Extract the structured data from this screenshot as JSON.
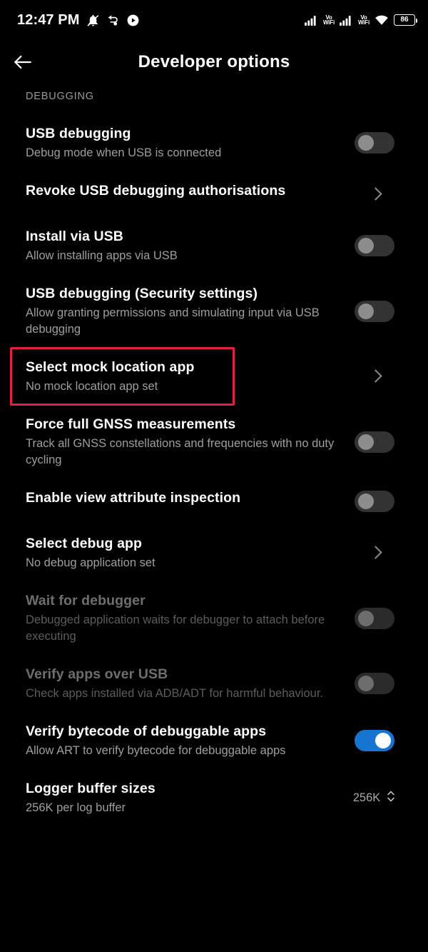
{
  "statusbar": {
    "clock": "12:47 PM",
    "left_icons": [
      "notifications-muted-icon",
      "data-saver-icon",
      "play-circle-icon"
    ],
    "signal_1_icon": "cellular-signal-icon",
    "vowifi_1": {
      "line1": "Vo",
      "line2": "WiFi"
    },
    "signal_2_icon": "cellular-signal-icon",
    "vowifi_2": {
      "line1": "Vo",
      "line2": "WiFi"
    },
    "wifi_icon": "wifi-icon",
    "battery_level": "86"
  },
  "appbar": {
    "back_icon": "back-arrow-icon",
    "title": "Developer options"
  },
  "section": {
    "header": "DEBUGGING"
  },
  "colors": {
    "background": "#000000",
    "accent_on": "#1675d1",
    "highlight": "#e3203f",
    "title": "#ffffff",
    "subtitle": "#9e9e9e",
    "disabled": "#6e6e6e"
  },
  "rows": [
    {
      "title": "USB debugging",
      "subtitle": "Debug mode when USB is connected",
      "accessory": "toggle",
      "toggle_on": false,
      "disabled": false,
      "name": "usb-debugging"
    },
    {
      "title": "Revoke USB debugging authorisations",
      "subtitle": "",
      "accessory": "chevron",
      "toggle_on": false,
      "disabled": false,
      "name": "revoke-usb-debugging-authorisations"
    },
    {
      "title": "Install via USB",
      "subtitle": "Allow installing apps via USB",
      "accessory": "toggle",
      "toggle_on": false,
      "disabled": false,
      "name": "install-via-usb"
    },
    {
      "title": "USB debugging (Security settings)",
      "subtitle": "Allow granting permissions and simulating input via USB debugging",
      "accessory": "toggle",
      "toggle_on": false,
      "disabled": false,
      "name": "usb-debugging-security-settings"
    },
    {
      "title": "Select mock location app",
      "subtitle": "No mock location app set",
      "accessory": "chevron",
      "toggle_on": false,
      "disabled": false,
      "name": "select-mock-location-app",
      "highlighted": true
    },
    {
      "title": "Force full GNSS measurements",
      "subtitle": "Track all GNSS constellations and frequencies with no duty cycling",
      "accessory": "toggle",
      "toggle_on": false,
      "disabled": false,
      "name": "force-full-gnss-measurements"
    },
    {
      "title": "Enable view attribute inspection",
      "subtitle": "",
      "accessory": "toggle",
      "toggle_on": false,
      "disabled": false,
      "name": "enable-view-attribute-inspection"
    },
    {
      "title": "Select debug app",
      "subtitle": "No debug application set",
      "accessory": "chevron",
      "toggle_on": false,
      "disabled": false,
      "name": "select-debug-app"
    },
    {
      "title": "Wait for debugger",
      "subtitle": "Debugged application waits for debugger to attach before executing",
      "accessory": "toggle",
      "toggle_on": false,
      "disabled": true,
      "name": "wait-for-debugger"
    },
    {
      "title": "Verify apps over USB",
      "subtitle": "Check apps installed via ADB/ADT for harmful behaviour.",
      "accessory": "toggle",
      "toggle_on": false,
      "disabled": true,
      "name": "verify-apps-over-usb"
    },
    {
      "title": "Verify bytecode of debuggable apps",
      "subtitle": "Allow ART to verify bytecode for debuggable apps",
      "accessory": "toggle",
      "toggle_on": true,
      "disabled": false,
      "name": "verify-bytecode-of-debuggable-apps"
    },
    {
      "title": "Logger buffer sizes",
      "subtitle": "256K per log buffer",
      "accessory": "stepper",
      "stepper_value": "256K",
      "toggle_on": false,
      "disabled": false,
      "name": "logger-buffer-sizes"
    }
  ]
}
